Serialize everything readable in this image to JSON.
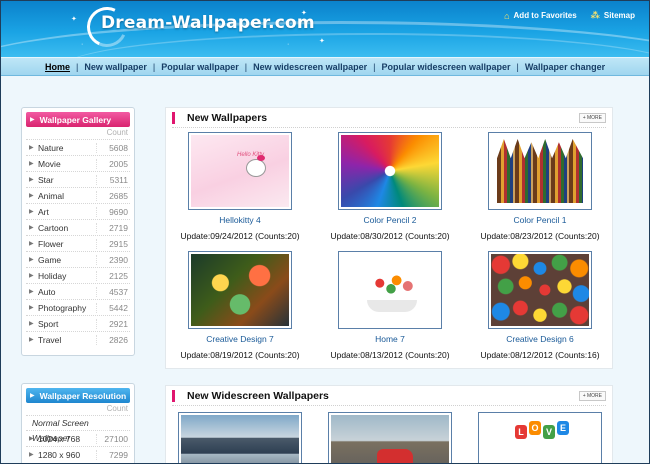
{
  "header": {
    "logo": "Dream-Wallpaper.com",
    "add_favorites": "Add to Favorites",
    "sitemap": "Sitemap"
  },
  "nav": {
    "items": [
      "Home",
      "New wallpaper",
      "Popular wallpaper",
      "New widescreen wallpaper",
      "Popular widescreen wallpaper",
      "Wallpaper changer"
    ],
    "separator": "|"
  },
  "gallery": {
    "title": "Wallpaper Gallery",
    "count_label": "Count",
    "items": [
      {
        "name": "Nature",
        "count": "5608"
      },
      {
        "name": "Movie",
        "count": "2005"
      },
      {
        "name": "Star",
        "count": "5311"
      },
      {
        "name": "Animal",
        "count": "2685"
      },
      {
        "name": "Art",
        "count": "9690"
      },
      {
        "name": "Cartoon",
        "count": "2719"
      },
      {
        "name": "Flower",
        "count": "2915"
      },
      {
        "name": "Game",
        "count": "2390"
      },
      {
        "name": "Holiday",
        "count": "2125"
      },
      {
        "name": "Auto",
        "count": "4537"
      },
      {
        "name": "Photography",
        "count": "5442"
      },
      {
        "name": "Sport",
        "count": "2921"
      },
      {
        "name": "Travel",
        "count": "2826"
      }
    ]
  },
  "resolution": {
    "title": "Wallpaper Resolution",
    "count_label": "Count",
    "subheading": "Normal Screen Wallpaper",
    "items": [
      {
        "name": "1024 x 768",
        "count": "27100"
      },
      {
        "name": "1280 x 960",
        "count": "7299"
      }
    ]
  },
  "new_wallpapers": {
    "title": "New Wallpapers",
    "more": "MORE",
    "items": [
      {
        "caption": "Hellokitty 4",
        "update": "Update:09/24/2012 (Counts:20)",
        "thumb_text": "Hello Kitty"
      },
      {
        "caption": "Color Pencil 2",
        "update": "Update:08/30/2012 (Counts:20)"
      },
      {
        "caption": "Color Pencil 1",
        "update": "Update:08/23/2012 (Counts:20)"
      },
      {
        "caption": "Creative Design 7",
        "update": "Update:08/19/2012 (Counts:20)"
      },
      {
        "caption": "Home 7",
        "update": "Update:08/13/2012 (Counts:20)"
      },
      {
        "caption": "Creative Design 6",
        "update": "Update:08/12/2012 (Counts:16)"
      }
    ]
  },
  "new_widescreen": {
    "title": "New Widescreen Wallpapers",
    "more": "MORE",
    "love_letters": [
      "L",
      "O",
      "V",
      "E"
    ]
  },
  "colors": {
    "header_blue": "#1aa3e4",
    "nav_blue": "#9fd6ef",
    "gallery_pink": "#e0156e",
    "resolution_blue": "#1e86cf",
    "link_blue": "#1a5a98"
  }
}
